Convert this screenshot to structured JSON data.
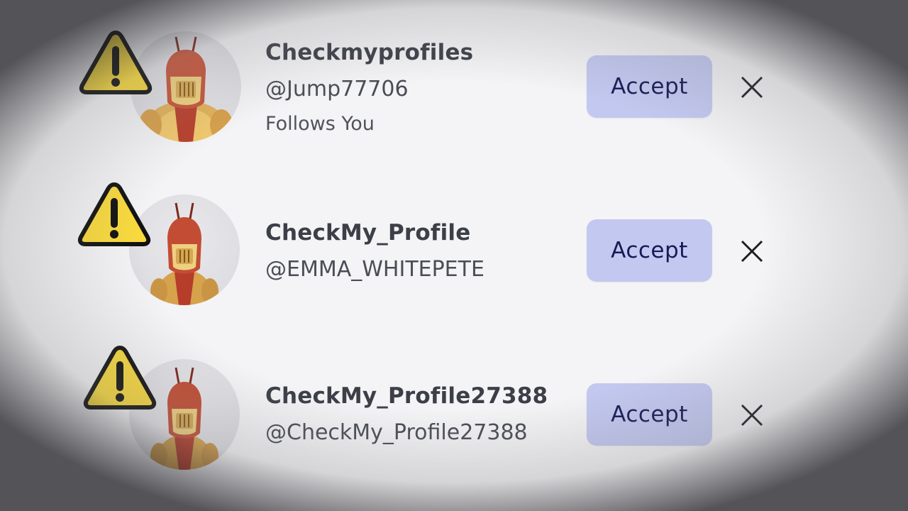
{
  "requests": [
    {
      "display_name": "Checkmyprofiles",
      "handle": "@Jump77706",
      "subtitle": "Follows You",
      "accept_label": "Accept",
      "warning_icon": "warning-triangle-icon",
      "decline_icon": "close-icon"
    },
    {
      "display_name": "CheckMy_Profile",
      "handle": "@EMMA_WHITEPETE",
      "accept_label": "Accept",
      "warning_icon": "warning-triangle-icon",
      "decline_icon": "close-icon"
    },
    {
      "display_name": "CheckMy_Profile27388",
      "handle": "@CheckMy_Profile27388",
      "accept_label": "Accept",
      "warning_icon": "warning-triangle-icon",
      "decline_icon": "close-icon"
    }
  ],
  "colors": {
    "accept_bg": "#c3c8f0",
    "accept_text": "#161a55",
    "warning_fill": "#f9da3c",
    "warning_stroke": "#111111",
    "name_text": "#3c3f47"
  }
}
